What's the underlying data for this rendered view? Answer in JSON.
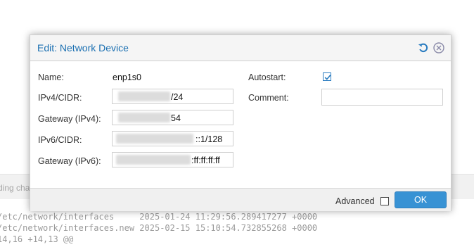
{
  "background": {
    "band_text": "ding cha",
    "diff_lines": [
      "/etc/network/interfaces     2025-01-24 11:29:56.289417277 +0000",
      "/etc/network/interfaces.new 2025-02-15 15:10:54.732855268 +0000",
      "14,16 +14,13 @@"
    ]
  },
  "dialog": {
    "title": "Edit: Network Device",
    "reset_icon": "reset-icon",
    "close_icon": "close-icon",
    "fields": {
      "name_label": "Name:",
      "name_value": "enp1s0",
      "ipv4_label": "IPv4/CIDR:",
      "ipv4_visible_suffix": "/24",
      "gateway4_label": "Gateway (IPv4):",
      "gateway4_visible_suffix": "54",
      "ipv6_label": "IPv6/CIDR:",
      "ipv6_visible_suffix": "::1/128",
      "gateway6_label": "Gateway (IPv6):",
      "gateway6_visible_suffix": ":ff:ff:ff:ff",
      "autostart_label": "Autostart:",
      "autostart_checked": true,
      "comment_label": "Comment:",
      "comment_value": ""
    },
    "footer": {
      "advanced_label": "Advanced",
      "advanced_checked": false,
      "ok_label": "OK"
    }
  },
  "colors": {
    "title": "#1a6fb1",
    "ok_button": "#3892d4",
    "checkbox": "#2a7cc0"
  }
}
